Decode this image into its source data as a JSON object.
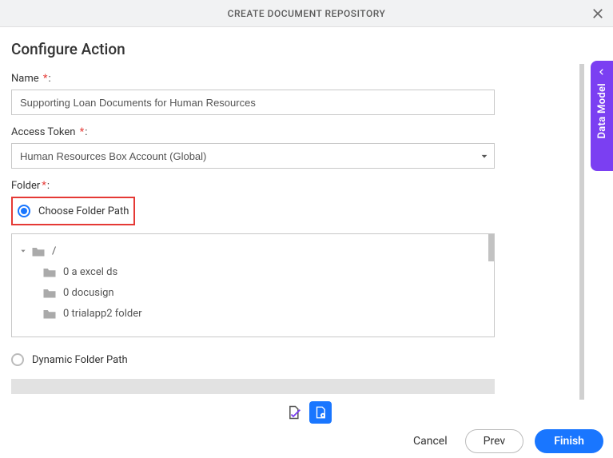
{
  "header": {
    "title": "CREATE DOCUMENT REPOSITORY"
  },
  "section": {
    "title": "Configure Action"
  },
  "fields": {
    "name": {
      "label": "Name",
      "value": "Supporting Loan Documents for Human Resources"
    },
    "access_token": {
      "label": "Access Token",
      "value": "Human Resources Box Account (Global)"
    },
    "folder": {
      "label": "Folder",
      "choose_label": "Choose Folder Path",
      "dynamic_label": "Dynamic Folder Path"
    }
  },
  "tree": {
    "root": "/",
    "items": [
      "0 a excel ds",
      "0 docusign",
      "0 trialapp2 folder"
    ]
  },
  "side_tab": {
    "label": "Data Model"
  },
  "buttons": {
    "cancel": "Cancel",
    "prev": "Prev",
    "finish": "Finish"
  }
}
